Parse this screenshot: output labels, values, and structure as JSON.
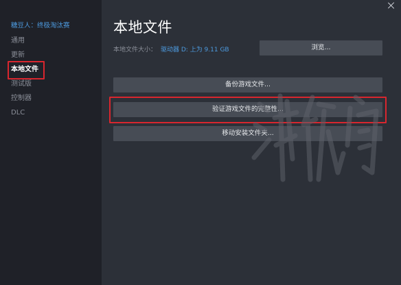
{
  "sidebar": {
    "game_title": "糖豆人：终极淘汰赛",
    "items": [
      {
        "label": "通用",
        "active": false
      },
      {
        "label": "更新",
        "active": false
      },
      {
        "label": "本地文件",
        "active": true
      },
      {
        "label": "测试版",
        "active": false
      },
      {
        "label": "控制器",
        "active": false
      },
      {
        "label": "DLC",
        "active": false
      }
    ]
  },
  "main": {
    "title": "本地文件",
    "size_label": "本地文件大小：",
    "size_value": "驱动器 D: 上为 9.11 GB",
    "browse_button": "浏览...",
    "backup_button": "备份游戏文件...",
    "verify_button": "验证游戏文件的完整性...",
    "move_button": "移动安装文件夹..."
  },
  "colors": {
    "sidebar_bg": "#1f2128",
    "panel_bg": "#2c3038",
    "button_bg": "#474c55",
    "accent_blue": "#4d9be0",
    "highlight_red": "#d9262e"
  },
  "icons": {
    "close": "close-icon"
  }
}
